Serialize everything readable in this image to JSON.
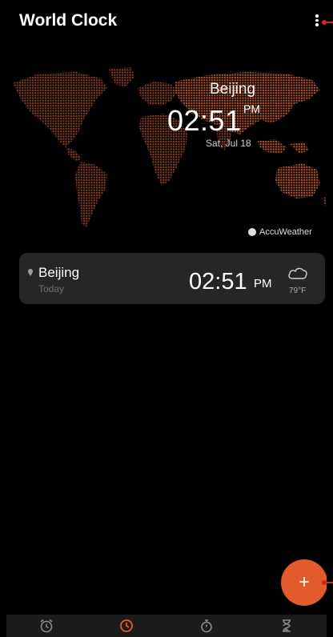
{
  "header": {
    "title": "World Clock",
    "more_icon": "more-vert-icon"
  },
  "main_clock": {
    "city": "Beijing",
    "time": "02:51",
    "ampm": "PM",
    "date": "Sat, Jul 18"
  },
  "attribution": {
    "label": "AccuWeather",
    "icon": "accuweather-icon"
  },
  "city_card": {
    "city": "Beijing",
    "day": "Today",
    "time": "02:51",
    "ampm": "PM",
    "weather_icon": "cloud-icon",
    "temperature": "79°F"
  },
  "fab": {
    "label": "+"
  },
  "tabs": [
    {
      "name": "alarm",
      "icon": "alarm-clock-icon",
      "active": false
    },
    {
      "name": "world-clock",
      "icon": "clock-icon",
      "active": true
    },
    {
      "name": "stopwatch",
      "icon": "stopwatch-icon",
      "active": false
    },
    {
      "name": "timer",
      "icon": "hourglass-icon",
      "active": false
    }
  ],
  "colors": {
    "accent": "#e15b2d",
    "map_dots": "#a14a2a",
    "annotation": "#d7261b",
    "card": "#262626"
  }
}
